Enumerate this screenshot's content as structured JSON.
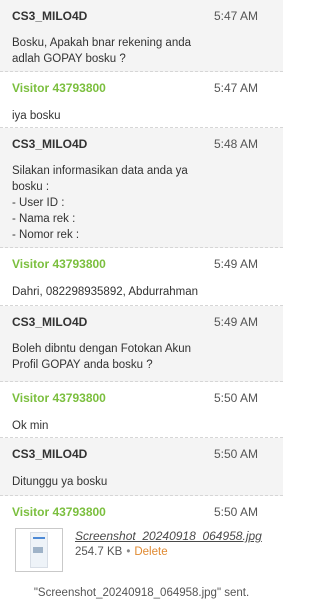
{
  "messages": [
    {
      "role": "op",
      "sender": "CS3_MILO4D",
      "time": "5:47 AM",
      "body": "Bosku, Apakah bnar rekening anda\nadlah GOPAY bosku ?"
    },
    {
      "role": "visitor",
      "sender": "Visitor 43793800",
      "time": "5:47 AM",
      "body": "iya bosku"
    },
    {
      "role": "op",
      "sender": "CS3_MILO4D",
      "time": "5:48 AM",
      "body": "Silakan informasikan data anda ya\nbosku :\n- User ID :\n- Nama rek :\n- Nomor rek :"
    },
    {
      "role": "visitor",
      "sender": "Visitor 43793800",
      "time": "5:49 AM",
      "body": "Dahri, 082298935892, Abdurrahman"
    },
    {
      "role": "op",
      "sender": "CS3_MILO4D",
      "time": "5:49 AM",
      "body": "Boleh dibntu dengan Fotokan Akun\nProfil GOPAY anda bosku ?"
    },
    {
      "role": "visitor",
      "sender": "Visitor 43793800",
      "time": "5:50 AM",
      "body": "Ok min"
    },
    {
      "role": "op",
      "sender": "CS3_MILO4D",
      "time": "5:50 AM",
      "body": "Ditunggu ya bosku"
    },
    {
      "role": "visitor",
      "sender": "Visitor 43793800",
      "time": "5:50 AM",
      "body": ""
    }
  ],
  "attachment": {
    "file_name": "Screenshot_20240918_064958.jpg",
    "size": "254.7 KB",
    "separator": "•",
    "delete_label": "Delete",
    "sent_note": "\"Screenshot_20240918_064958.jpg\" sent."
  }
}
